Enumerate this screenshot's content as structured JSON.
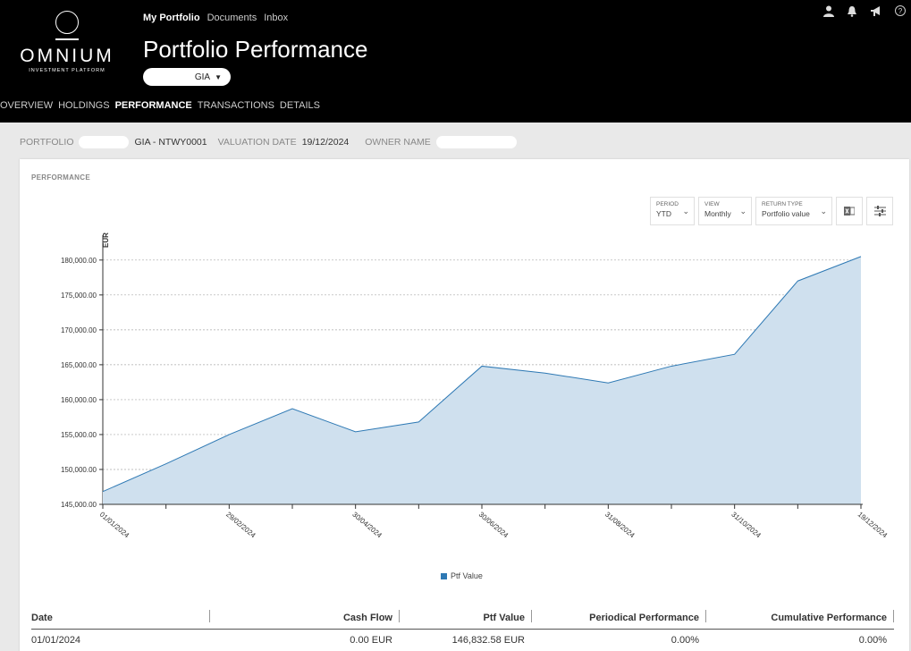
{
  "brand": {
    "name": "OMNIUM",
    "tagline": "INVESTMENT PLATFORM"
  },
  "topnav": {
    "items": [
      "My Portfolio",
      "Documents",
      "Inbox"
    ]
  },
  "page_title": "Portfolio Performance",
  "portfolio_select": {
    "value": "GIA"
  },
  "tabs": [
    "OVERVIEW",
    "HOLDINGS",
    "PERFORMANCE",
    "TRANSACTIONS",
    "DETAILS"
  ],
  "header_icons": [
    "user-icon",
    "bell-icon",
    "megaphone-icon",
    "help-icon"
  ],
  "infobar": {
    "portfolio_label": "PORTFOLIO",
    "portfolio_value": "GIA - NTWY0001",
    "valuation_label": "VALUATION DATE",
    "valuation_value": "19/12/2024",
    "owner_label": "OWNER NAME"
  },
  "card": {
    "title": "PERFORMANCE",
    "controls": {
      "period": {
        "label": "PERIOD",
        "value": "YTD"
      },
      "view": {
        "label": "VIEW",
        "value": "Monthly"
      },
      "return_type": {
        "label": "RETURN TYPE",
        "value": "Portfolio value"
      }
    }
  },
  "legend": {
    "label": "Ptf Value"
  },
  "chart_data": {
    "type": "area",
    "ylabel": "EUR",
    "ylim": [
      145000,
      181000
    ],
    "yticks": [
      "145,000.00",
      "150,000.00",
      "155,000.00",
      "160,000.00",
      "165,000.00",
      "170,000.00",
      "175,000.00",
      "180,000.00"
    ],
    "x_tick_labels": [
      "01/01/2024",
      "29/02/2024",
      "30/04/2024",
      "30/06/2024",
      "31/08/2024",
      "31/10/2024",
      "19/12/2024"
    ],
    "grid": true,
    "legend": "bottom-center",
    "color": "#2e79b4",
    "fill": "#cfe0ee",
    "series": [
      {
        "name": "Ptf Value",
        "x": [
          "01/01/2024",
          "31/01/2024",
          "29/02/2024",
          "31/03/2024",
          "30/04/2024",
          "31/05/2024",
          "30/06/2024",
          "31/07/2024",
          "31/08/2024",
          "30/09/2024",
          "31/10/2024",
          "30/11/2024",
          "19/12/2024"
        ],
        "values": [
          146832.58,
          150800,
          155000,
          158700,
          155400,
          156800,
          164800,
          163800,
          162400,
          164800,
          166500,
          177000,
          180500
        ]
      }
    ]
  },
  "table": {
    "headers": [
      "Date",
      "Cash Flow",
      "Ptf Value",
      "Periodical Performance",
      "Cumulative Performance"
    ],
    "rows": [
      [
        "01/01/2024",
        "0.00 EUR",
        "146,832.58 EUR",
        "0.00%",
        "0.00%"
      ]
    ]
  }
}
